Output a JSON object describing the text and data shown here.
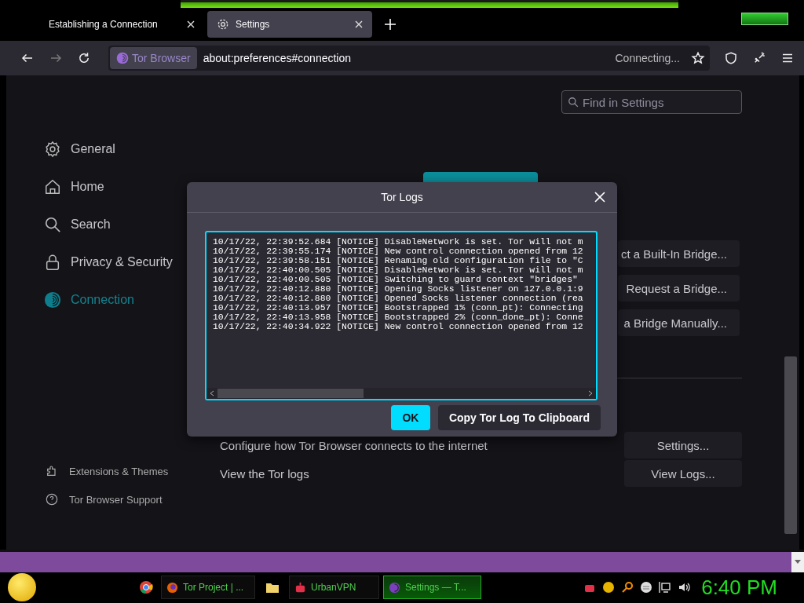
{
  "tabs": [
    {
      "label": "Establishing a Connection",
      "selected": false
    },
    {
      "label": "Settings",
      "selected": true
    }
  ],
  "toolbar": {
    "identity": "Tor Browser",
    "url": "about:preferences#connection",
    "status": "Connecting..."
  },
  "search": {
    "placeholder": "Find in Settings"
  },
  "sidebar": {
    "items": [
      {
        "label": "General",
        "selected": false
      },
      {
        "label": "Home",
        "selected": false
      },
      {
        "label": "Search",
        "selected": false
      },
      {
        "label": "Privacy & Security",
        "selected": false
      },
      {
        "label": "Connection",
        "selected": true
      }
    ],
    "footer": [
      "Extensions & Themes",
      "Tor Browser Support"
    ]
  },
  "bridge_buttons": [
    "ct a Built-In Bridge...",
    "Request a Bridge...",
    "a Bridge Manually..."
  ],
  "settings_rows": [
    {
      "label": "Configure how Tor Browser connects to the internet",
      "button": "Settings..."
    },
    {
      "label": "View the Tor logs",
      "button": "View Logs..."
    }
  ],
  "dialog": {
    "title": "Tor Logs",
    "lines": [
      "10/17/22, 22:39:52.684 [NOTICE] DisableNetwork is set. Tor will not m",
      "10/17/22, 22:39:55.174 [NOTICE] New control connection opened from 12",
      "10/17/22, 22:39:58.151 [NOTICE] Renaming old configuration file to \"C",
      "10/17/22, 22:40:00.505 [NOTICE] DisableNetwork is set. Tor will not m",
      "10/17/22, 22:40:00.505 [NOTICE] Switching to guard context \"bridges\"",
      "10/17/22, 22:40:12.880 [NOTICE] Opening Socks listener on 127.0.0.1:9",
      "10/17/22, 22:40:12.880 [NOTICE] Opened Socks listener connection (rea",
      "10/17/22, 22:40:13.957 [NOTICE] Bootstrapped 1% (conn_pt): Connecting",
      "10/17/22, 22:40:13.958 [NOTICE] Bootstrapped 2% (conn_done_pt): Conne",
      "10/17/22, 22:40:34.922 [NOTICE] New control connection opened from 12"
    ],
    "buttons": [
      "OK",
      "Copy Tor Log To Clipboard"
    ]
  },
  "taskbar": {
    "items": [
      {
        "label": "Tor Project | ...",
        "selected": false
      },
      {
        "label": "UrbanVPN",
        "selected": false
      },
      {
        "label": "Settings — T...",
        "selected": true
      }
    ],
    "clock": "6:40 PM"
  }
}
